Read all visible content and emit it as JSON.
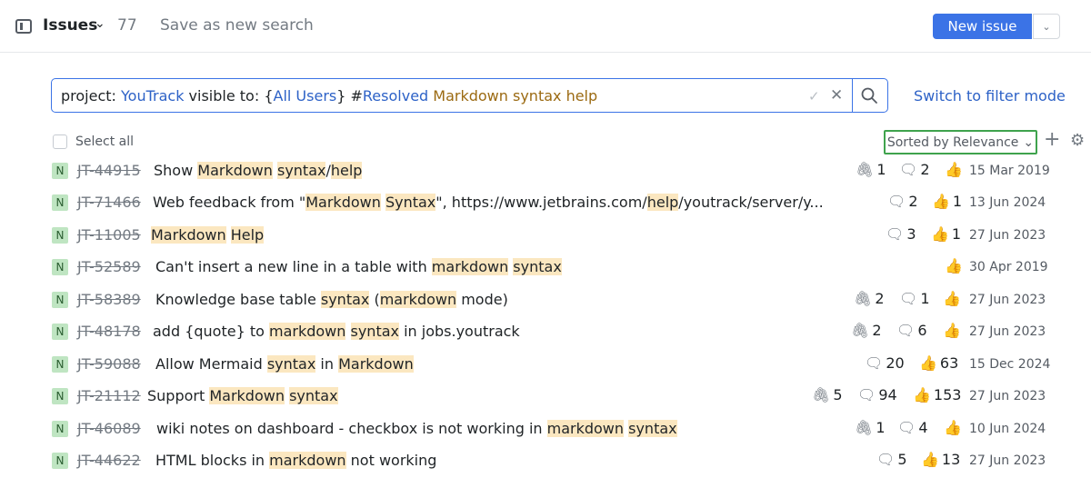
{
  "header": {
    "title": "Issues",
    "count": "77",
    "save_search": "Save as new search",
    "new_issue": "New issue"
  },
  "search": {
    "query_parts": [
      "project: ",
      "YouTrack",
      " visible to: {",
      "All Users",
      "} #",
      "Resolved",
      " ",
      "Markdown syntax help"
    ],
    "switch_mode": "Switch to filter mode"
  },
  "toolbar": {
    "select_all": "Select all",
    "sort": "Sorted by Relevance"
  },
  "issues": [
    {
      "badge": "N",
      "id": "JT-44915",
      "summary": [
        "Show ",
        "Markdown",
        " ",
        "syntax",
        "/",
        "help"
      ],
      "attachments": "1",
      "comments": "2",
      "votes": "",
      "date": "15 Mar 2019"
    },
    {
      "badge": "N",
      "id": "JT-71466",
      "summary": [
        "Web feedback from \"",
        "Markdown",
        " ",
        "Syntax",
        "\", https://www.jetbrains.com/",
        "help",
        "/youtrack/server/y..."
      ],
      "attachments": "",
      "comments": "2",
      "votes": "1",
      "date": "13 Jun 2024"
    },
    {
      "badge": "N",
      "id": "JT-11005",
      "summary": [
        "",
        "Markdown",
        " ",
        "Help"
      ],
      "attachments": "",
      "comments": "3",
      "votes": "1",
      "date": "27 Jun 2023"
    },
    {
      "badge": "N",
      "id": "JT-52589",
      "summary": [
        "Can't insert a new line in a table with ",
        "markdown",
        " ",
        "syntax"
      ],
      "attachments": "",
      "comments": "",
      "votes": "",
      "date": "30 Apr 2019"
    },
    {
      "badge": "N",
      "id": "JT-58389",
      "summary": [
        "Knowledge base table ",
        "syntax",
        " (",
        "markdown",
        " mode)"
      ],
      "attachments": "2",
      "comments": "1",
      "votes": "",
      "date": "27 Jun 2023"
    },
    {
      "badge": "N",
      "id": "JT-48178",
      "summary": [
        "add {quote} to ",
        "markdown",
        " ",
        "syntax",
        " in jobs.youtrack"
      ],
      "attachments": "2",
      "comments": "6",
      "votes": "",
      "date": "27 Jun 2023"
    },
    {
      "badge": "N",
      "id": "JT-59088",
      "summary": [
        "Allow Mermaid ",
        "syntax",
        " in ",
        "Markdown"
      ],
      "attachments": "",
      "comments": "20",
      "votes": "63",
      "date": "15 Dec 2024"
    },
    {
      "badge": "N",
      "id": "JT-21112",
      "summary": [
        "Support ",
        "Markdown",
        " ",
        "syntax"
      ],
      "attachments": "5",
      "comments": "94",
      "votes": "153",
      "date": "27 Jun 2023"
    },
    {
      "badge": "N",
      "id": "JT-46089",
      "summary": [
        "wiki notes on dashboard - checkbox is not working in ",
        "markdown",
        " ",
        "syntax"
      ],
      "attachments": "1",
      "comments": "4",
      "votes": "",
      "date": "10 Jun 2024"
    },
    {
      "badge": "N",
      "id": "JT-44622",
      "summary": [
        "HTML blocks in ",
        "markdown",
        " not working"
      ],
      "attachments": "",
      "comments": "5",
      "votes": "13",
      "date": "27 Jun 2023"
    }
  ],
  "colors": {
    "accent": "#3b73e6",
    "highlight": "#fbe7c0",
    "badge": "#bfe5c2",
    "sort_border": "#3fa34d"
  }
}
